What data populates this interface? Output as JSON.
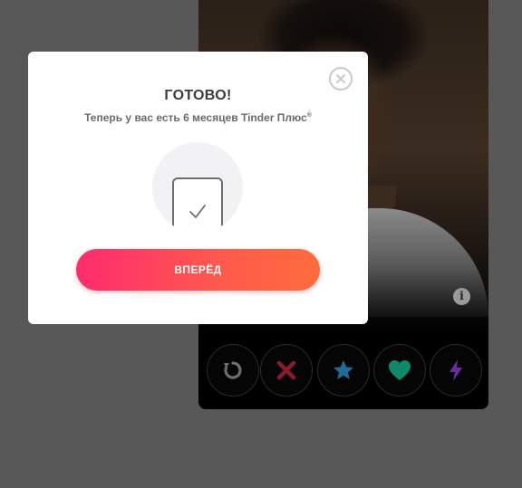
{
  "modal": {
    "title": "ГОТОВО!",
    "subtitle": "Теперь у вас есть 6 месяцев Tinder Плюс",
    "subtitle_mark": "®",
    "cta_label": "ВПЕРЁД",
    "close_icon": "close-icon",
    "illustration_icon": "checkbox-check-icon"
  },
  "card": {
    "info_icon_glyph": "i",
    "actions": [
      {
        "name": "rewind",
        "icon": "rewind-icon",
        "color": "#6e6e6e"
      },
      {
        "name": "nope",
        "icon": "x-icon",
        "color": "#8b1a2c"
      },
      {
        "name": "super-like",
        "icon": "star-icon",
        "color": "#1f6c9a"
      },
      {
        "name": "like",
        "icon": "heart-icon",
        "color": "#0d8a69"
      },
      {
        "name": "boost",
        "icon": "lightning-icon",
        "color": "#6b2aa3"
      }
    ]
  },
  "colors": {
    "cta_gradient_start": "#ff2b6f",
    "cta_gradient_end": "#ff6c3c",
    "backdrop": "#585858"
  }
}
